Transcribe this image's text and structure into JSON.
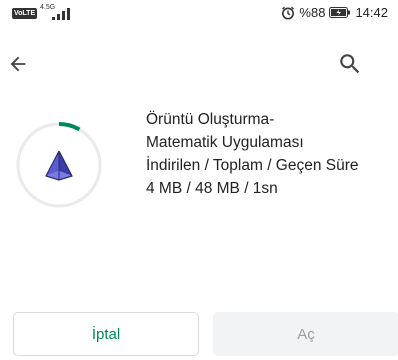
{
  "status_bar": {
    "volte": "VoLTE",
    "network": "4.5G",
    "battery_percent": "%88",
    "time": "14:42"
  },
  "toolbar": {
    "back_icon": "arrow-back-icon",
    "search_icon": "search-icon"
  },
  "download": {
    "app_name_line1": "Örüntü Oluşturma-",
    "app_name_line2": "Matematik Uygulaması",
    "progress_label": "İndirilen / Toplam / Geçen Süre",
    "progress_values": "4 MB / 48 MB / 1sn",
    "progress_fraction": 0.083,
    "app_icon": "pyramid-icon"
  },
  "actions": {
    "cancel_label": "İptal",
    "open_label": "Aç"
  },
  "colors": {
    "accent": "#01875f",
    "ring_track": "#e8eaed",
    "pyramid_primary": "#5b5bd6",
    "pyramid_dark": "#2b2b6e"
  }
}
